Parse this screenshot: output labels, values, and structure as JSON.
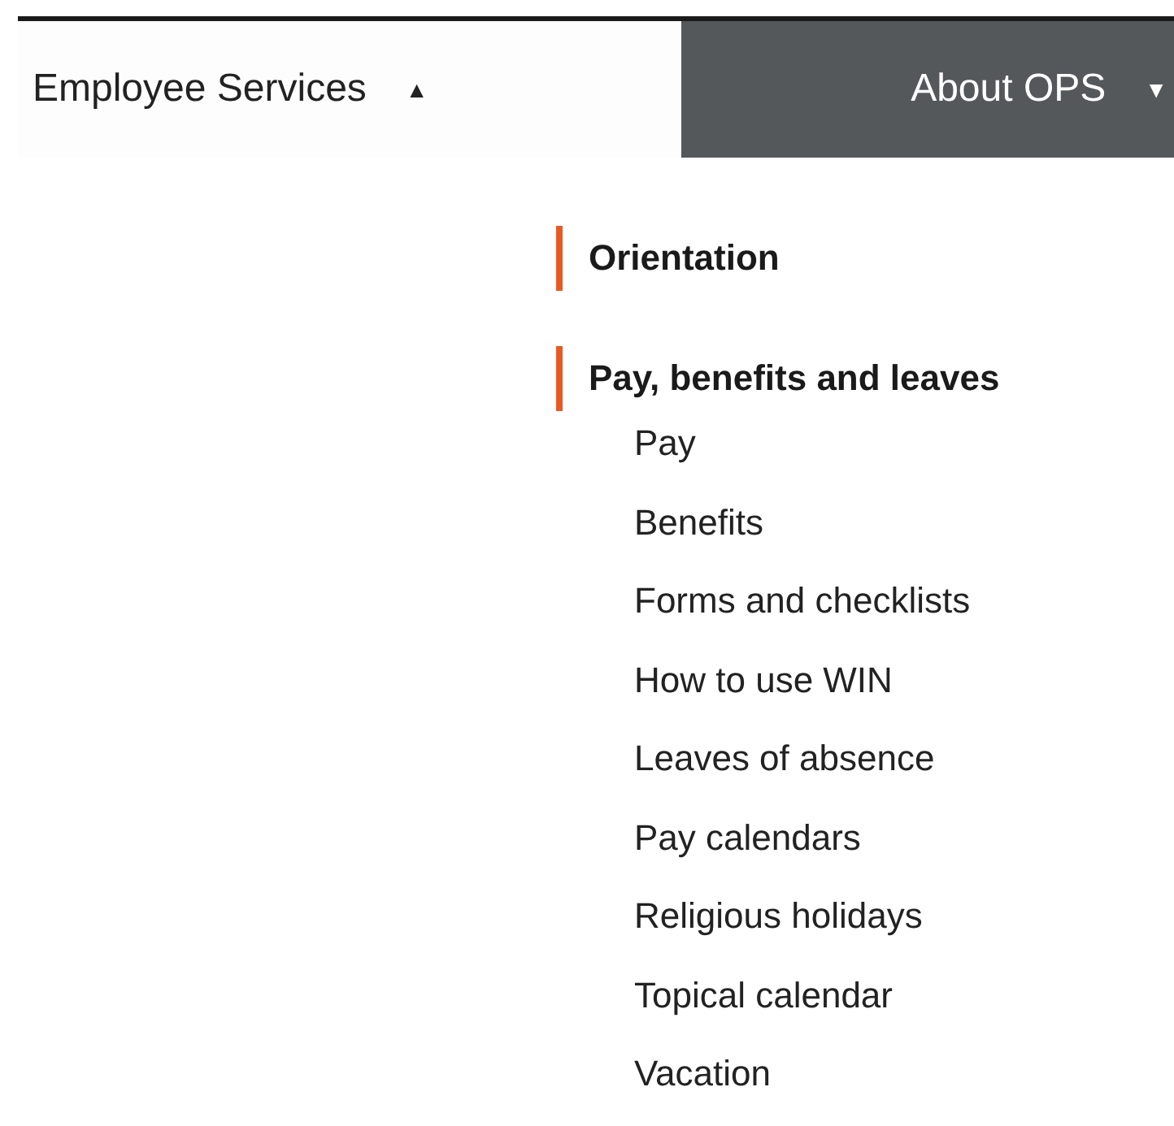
{
  "nav": [
    {
      "label": "Employee Services",
      "caret": "▲",
      "expanded": true
    },
    {
      "label": "About OPS",
      "caret": "▼",
      "expanded": false
    }
  ],
  "menu": [
    {
      "title": "Orientation"
    },
    {
      "title": "Pay, benefits and leaves",
      "items": [
        "Pay",
        "Benefits",
        "Forms and checklists",
        "How to use WIN",
        "Leaves of absence",
        "Pay calendars",
        "Religious holidays",
        "Topical calendar",
        "Vacation"
      ]
    }
  ]
}
